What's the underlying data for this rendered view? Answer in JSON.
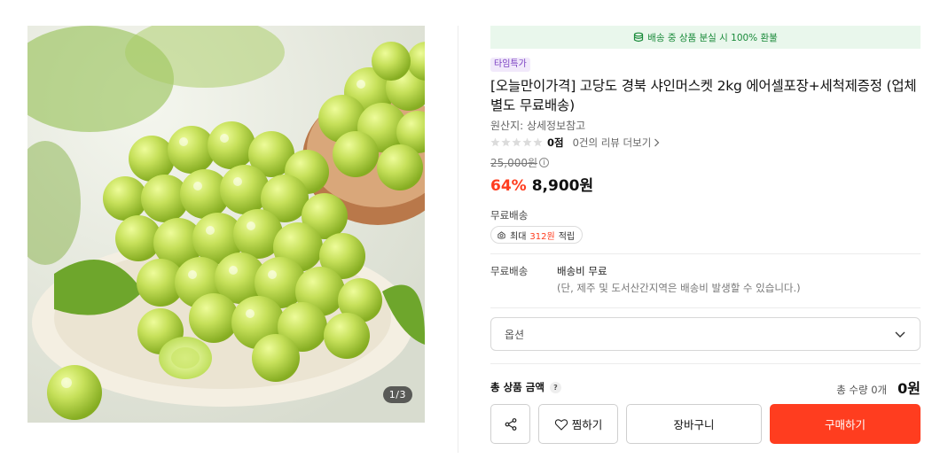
{
  "gallery": {
    "counter": "1/3"
  },
  "banner": {
    "text": "배송 중 상품 분실 시 100% 환불",
    "icon": "shield-icon",
    "color": "#1a8a3a"
  },
  "product": {
    "badge": "타임특가",
    "title": "[오늘만이가격] 고당도 경북 샤인머스켓 2kg 에어셀포장+세척제증정 (업체별도 무료배송)",
    "origin": "원산지: 상세정보참고",
    "rating_score": "0점",
    "reviews": "0건의 리뷰 더보기",
    "original_price": "25,000원",
    "discount": "64%",
    "sale_price": "8,900원",
    "accent_color": "#ff3d1f"
  },
  "shipping": {
    "label": "무료배송",
    "points_prefix": "최대",
    "points_amount": "312원",
    "points_suffix": "적립",
    "detail_label": "무료배송",
    "detail_main": "배송비 무료",
    "detail_note": "(단, 제주 및 도서산간지역은 배송비 발생할 수 있습니다.)"
  },
  "option": {
    "placeholder": "옵션"
  },
  "total": {
    "label": "총 상품 금액",
    "help": "?",
    "quantity": "총 수량 0개",
    "amount": "0원"
  },
  "actions": {
    "wish": "찜하기",
    "cart": "장바구니",
    "buy": "구매하기"
  }
}
